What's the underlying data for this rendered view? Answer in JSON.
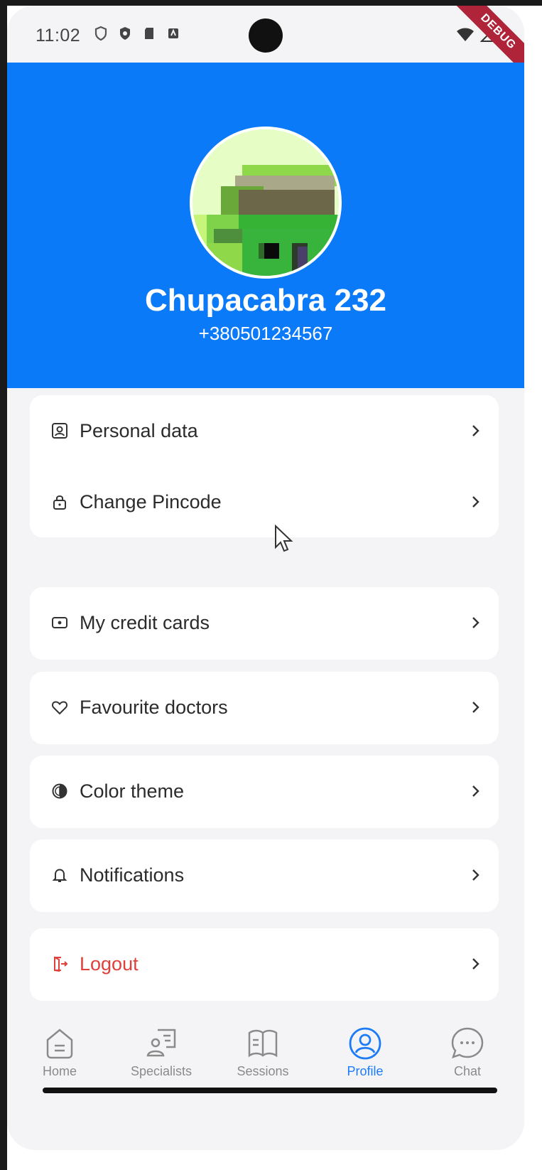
{
  "status_bar": {
    "time": "11:02",
    "debug_label": "DEBUG"
  },
  "profile": {
    "name": "Chupacabra 232",
    "phone": "+380501234567"
  },
  "menu": {
    "personal_data": "Personal data",
    "change_pincode": "Change Pincode",
    "my_credit_cards": "My credit cards",
    "favourite_doctors": "Favourite doctors",
    "color_theme": "Color theme",
    "notifications": "Notifications",
    "logout": "Logout"
  },
  "nav": {
    "home": "Home",
    "specialists": "Specialists",
    "sessions": "Sessions",
    "profile": "Profile",
    "chat": "Chat",
    "active": "profile"
  },
  "colors": {
    "header_blue": "#0b7af8",
    "logout_red": "#e0403c",
    "active_nav": "#1c7cf7",
    "debug_ribbon": "#b0243a"
  }
}
